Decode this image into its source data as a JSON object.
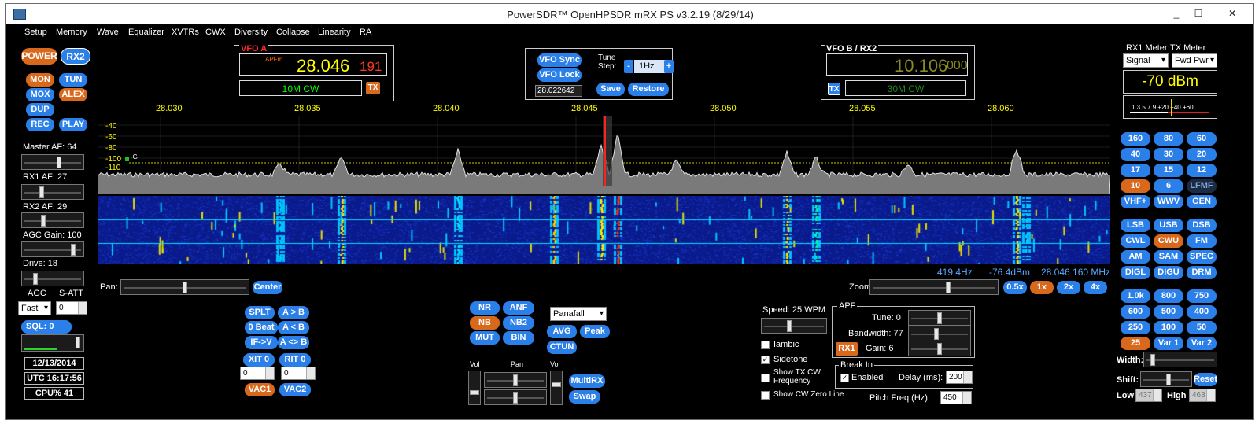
{
  "window": {
    "title": "PowerSDR™ OpenHPSDR mRX PS v3.2.19 (8/29/14)",
    "min": "_",
    "max": "☐",
    "close": "✕"
  },
  "menu": [
    "Setup",
    "Memory",
    "Wave",
    "Equalizer",
    "XVTRs",
    "CWX",
    "Diversity",
    "Collapse",
    "Linearity",
    "RA"
  ],
  "left": {
    "power": "POWER",
    "rx2": "RX2",
    "mon": "MON",
    "tun": "TUN",
    "mox": "MOX",
    "alex": "ALEX",
    "dup": "DUP",
    "rec": "REC",
    "play": "PLAY",
    "master_af": "Master AF:  64",
    "rx1_af": "RX1 AF:  27",
    "rx2_af": "RX2 AF:  29",
    "agc_gain": "AGC Gain:  100",
    "drive": "Drive:  18",
    "agc": "AGC",
    "satt": "S-ATT",
    "agc_mode": "Fast",
    "satt_value": "0",
    "sql": "SQL: 0",
    "date": "12/13/2014",
    "utc": "UTC 16:17:56",
    "cpu": "CPU%  41"
  },
  "vfoa": {
    "title": "VFO A",
    "mode_tag": "APFm",
    "freq": "28.046",
    "sub": "191",
    "band": "10M CW",
    "tx": "TX"
  },
  "vfo_mid": {
    "sync": "VFO Sync",
    "lock": "VFO Lock",
    "tune_step_label": "Tune\nStep:",
    "step_minus": "-",
    "step": "1Hz",
    "step_plus": "+",
    "memory_freq": "28.022642",
    "save": "Save",
    "restore": "Restore"
  },
  "vfob": {
    "title": "VFO B / RX2",
    "freq": "10.106",
    "sub": "000",
    "tx": "TX",
    "band": "30M CW"
  },
  "meter": {
    "rx1_label": "RX1 Meter",
    "tx_label": "TX Meter",
    "rx1_sel": "Signal",
    "tx_sel": "Fwd Pwr",
    "reading": "-70 dBm",
    "scale": "1  3  5  7  9  +20 +40 +60"
  },
  "spectrum": {
    "freqs": [
      "28.030",
      "28.035",
      "28.040",
      "28.045",
      "28.050",
      "28.055",
      "28.060"
    ],
    "db": [
      "-40",
      "-60",
      "-80",
      "-100",
      "-110"
    ],
    "cursor_tag": "-G",
    "readout": {
      "offset": "419.4Hz",
      "dbm": "-76.4dBm",
      "freq": "28.046 160 MHz"
    }
  },
  "pan": {
    "label": "Pan:",
    "center": "Center",
    "zoom_label": "Zoom:",
    "zoom": [
      "0.5x",
      "1x",
      "2x",
      "4x"
    ]
  },
  "bands": [
    "160",
    "80",
    "60",
    "40",
    "30",
    "20",
    "17",
    "15",
    "12",
    "10",
    "6",
    "LFMF",
    "VHF+",
    "WWV",
    "GEN"
  ],
  "modes": [
    "LSB",
    "USB",
    "DSB",
    "CWL",
    "CWU",
    "FM",
    "AM",
    "SAM",
    "SPEC",
    "DIGL",
    "DIGU",
    "DRM"
  ],
  "filters": [
    "1.0k",
    "800",
    "750",
    "600",
    "500",
    "400",
    "250",
    "100",
    "50",
    "25",
    "Var 1",
    "Var 2"
  ],
  "filter_ctrl": {
    "width": "Width:",
    "shift": "Shift:",
    "reset": "Reset",
    "low": "Low",
    "high": "High",
    "low_val": "437",
    "high_val": "463"
  },
  "vfo_ops": {
    "splt": "SPLT",
    "atob": "A > B",
    "zerobeat": "0 Beat",
    "btoa": "A < B",
    "ifv": "IF->V",
    "swap": "A <> B",
    "xit": "XIT",
    "xit_v": "0",
    "rit": "RIT",
    "rit_v": "0",
    "xit_spin": "0",
    "rit_spin": "0",
    "vac1": "VAC1",
    "vac2": "VAC2"
  },
  "dsp": {
    "nr": "NR",
    "anf": "ANF",
    "nb": "NB",
    "nb2": "NB2",
    "mut": "MUT",
    "bin": "BIN",
    "display": "Panafall",
    "avg": "AVG",
    "peak": "Peak",
    "ctun": "CTUN"
  },
  "mix": {
    "vol1": "Vol",
    "pan": "Pan",
    "vol2": "Vol",
    "multirx": "MultiRX",
    "swap": "Swap"
  },
  "cw": {
    "speed": "Speed:  25 WPM",
    "iambic": "Iambic",
    "sidetone": "Sidetone",
    "show_tx": "Show TX CW\nFrequency",
    "show_zero": "Show CW Zero Line",
    "apf_title": "APF",
    "tune": "Tune:  0",
    "bandwidth": "Bandwidth:  77",
    "rx1": "RX1",
    "gain": "Gain:  6",
    "breakin": "Break In",
    "enabled": "Enabled",
    "delay_label": "Delay (ms):",
    "delay": "200",
    "pitch_label": "Pitch Freq (Hz):",
    "pitch": "450"
  }
}
